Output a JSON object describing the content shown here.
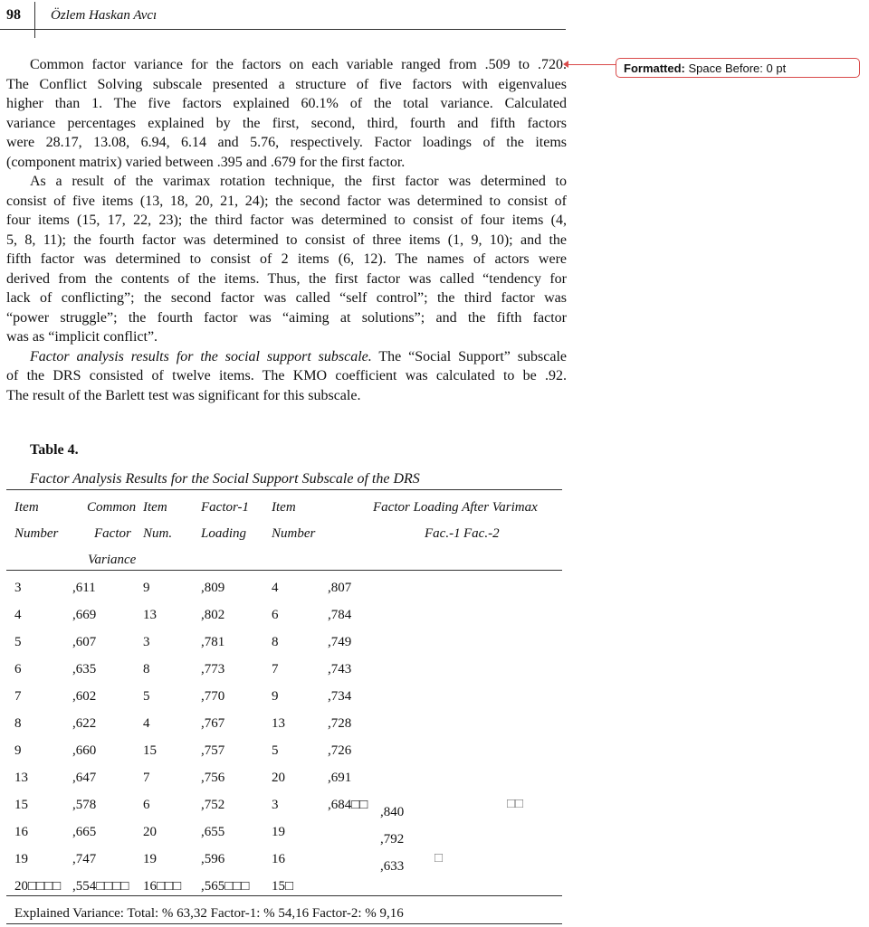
{
  "header": {
    "page_number": "98",
    "author": "Özlem Haskan Avcı"
  },
  "comment": {
    "label": "Formatted:",
    "text": "Space Before:  0 pt",
    "color": "#d94a4a"
  },
  "body_lines": [
    {
      "text": "Common factor variance for the factors on each variable ranged from .509 to .720.",
      "indent": true
    },
    {
      "text": "The Conflict Solving subscale presented a structure of five factors with eigenvalues"
    },
    {
      "text": "higher than 1. The five factors explained 60.1% of the total variance. Calculated"
    },
    {
      "text": "variance percentages explained by the first, second, third, fourth and fifth factors"
    },
    {
      "text": "were 28.17, 13.08, 6.94, 6.14 and 5.76, respectively. Factor loadings of the items"
    },
    {
      "text": "(component matrix) varied between .395 and .679 for the first factor.",
      "last": true
    },
    {
      "text": "As a result of the varimax rotation technique, the first factor was determined to",
      "indent": true
    },
    {
      "text": "consist of five items (13, 18, 20, 21, 24); the second factor was determined to consist of"
    },
    {
      "text": "four items (15, 17, 22, 23); the third factor was determined to consist of four items (4,"
    },
    {
      "text": "5, 8, 11); the fourth factor was determined to consist of three items (1, 9, 10); and the"
    },
    {
      "text": "fifth factor was determined to consist of 2 items (6, 12). The names of actors were"
    },
    {
      "text": "derived from the contents of the items. Thus, the first factor was called “tendency for"
    },
    {
      "text": "lack of conflicting”; the second factor was called “self control”; the third factor was"
    },
    {
      "text": "“power struggle”; the fourth factor was “aiming at solutions”; and the fifth factor"
    },
    {
      "text": "was as “implicit conflict”.",
      "last": true
    },
    {
      "italic": "Factor analysis results for the social support subscale.",
      "text": " The “Social Support” subscale",
      "indent": true
    },
    {
      "text": "of the DRS consisted of twelve items. The KMO coefficient was calculated to be .92."
    },
    {
      "text": "The result of the Barlett test was significant for this subscale.",
      "last": true
    }
  ],
  "table": {
    "label": "Table 4.",
    "title": "Factor Analysis Results for the Social Support Subscale of the DRS",
    "headers": {
      "item_number": [
        "Item",
        "Number"
      ],
      "common_factor_variance": [
        "Common",
        "Factor",
        "Variance"
      ],
      "item_num": [
        "Item",
        "Num."
      ],
      "factor1_loading": [
        "Factor-1",
        "Loading"
      ],
      "item_number2": [
        "Item",
        "Number"
      ],
      "varimax": "Factor Loading After Varimax",
      "fac1": "Fac.-1",
      "fac2": "Fac.-2"
    },
    "rows": [
      [
        "3",
        ",611",
        "9",
        ",809",
        "4",
        ",807"
      ],
      [
        "4",
        ",669",
        "13",
        ",802",
        "6",
        ",784"
      ],
      [
        "5",
        ",607",
        "3",
        ",781",
        "8",
        ",749"
      ],
      [
        "6",
        ",635",
        "8",
        ",773",
        "7",
        ",743"
      ],
      [
        "7",
        ",602",
        "5",
        ",770",
        "9",
        ",734"
      ],
      [
        "8",
        ",622",
        "4",
        ",767",
        "13",
        ",728"
      ],
      [
        "9",
        ",660",
        "15",
        ",757",
        "5",
        ",726"
      ],
      [
        "13",
        ",647",
        "7",
        ",756",
        "20",
        ",691"
      ],
      [
        "15",
        ",578",
        "6",
        ",752",
        "3",
        ",684□□"
      ],
      [
        "16",
        ",665",
        "20",
        ",655",
        "19",
        ""
      ],
      [
        "19",
        ",747",
        "19",
        ",596",
        "16",
        ""
      ],
      [
        "20□□□□",
        ",554□□□□",
        "16□□□",
        ",565□□□",
        "15□",
        ""
      ]
    ],
    "fac2_values": [
      ",840",
      ",792",
      ",633"
    ],
    "stray_marks": [
      "□□",
      "□"
    ],
    "footer": "Explained Variance: Total: % 63,32  Factor-1: % 54,16  Factor-2: % 9,16"
  }
}
